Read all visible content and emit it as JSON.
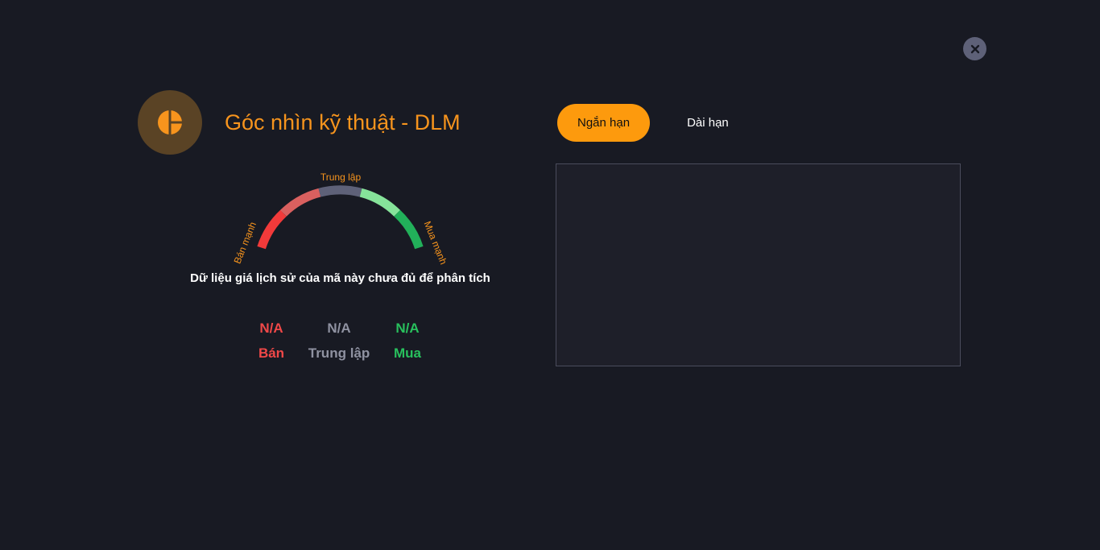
{
  "header": {
    "title": "Góc nhìn kỹ thuật - DLM",
    "logo_icon": "pie-chart-icon",
    "close_icon": "close-icon"
  },
  "tabs": [
    {
      "label": "Ngắn hạn",
      "active": true
    },
    {
      "label": "Dài hạn",
      "active": false
    }
  ],
  "gauge": {
    "label_left": "Bán mạnh",
    "label_top": "Trung lập",
    "label_right": "Mua mạnh",
    "segment_colors": [
      "#f23a3a",
      "#d9605f",
      "#5e6178",
      "#86e39a",
      "#22b05a"
    ]
  },
  "message": "Dữ liệu giá lịch sử của mã này chưa đủ để phân tích",
  "stats": {
    "sell": {
      "value": "N/A",
      "label": "Bán"
    },
    "neutral": {
      "value": "N/A",
      "label": "Trung lập"
    },
    "buy": {
      "value": "N/A",
      "label": "Mua"
    }
  },
  "colors": {
    "background": "#181a23",
    "accent": "#f7941d",
    "tab_active": "#fd9a0d",
    "sell": "#f04848",
    "neutral": "#8f92a1",
    "buy": "#28c05d"
  }
}
